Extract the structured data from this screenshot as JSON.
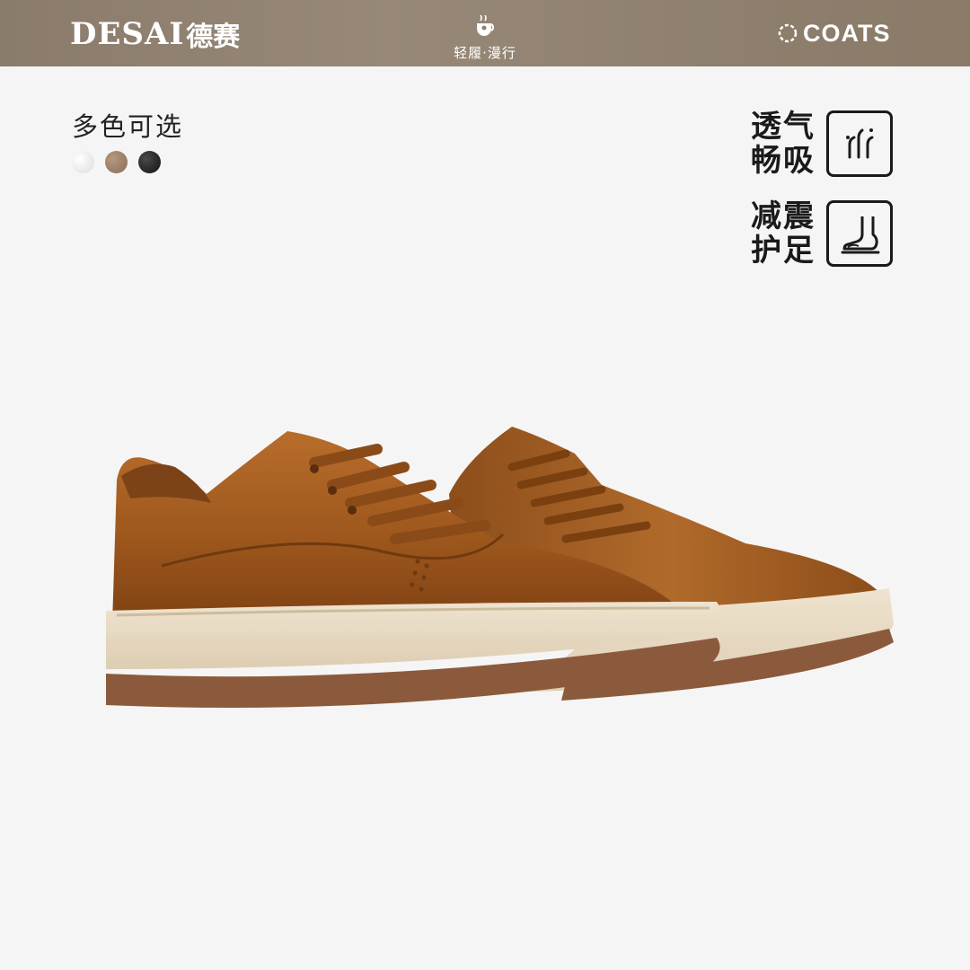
{
  "header": {
    "brand_en": "DESAI",
    "brand_cn": "德赛",
    "slogan": "轻履·漫行",
    "partner": "COATS",
    "bg_color": "#8f806f"
  },
  "colors": {
    "title": "多色可选",
    "swatches": [
      {
        "name": "white",
        "color": "#ececea"
      },
      {
        "name": "brown",
        "color": "#9a7d66"
      },
      {
        "name": "black",
        "color": "#1c1c1c"
      }
    ]
  },
  "features": [
    {
      "line1": "透气",
      "line2": "畅吸",
      "icon": "airflow-icon"
    },
    {
      "line1": "减震",
      "line2": "护足",
      "icon": "foot-cushion-icon"
    }
  ],
  "product": {
    "icon": "shoe-image",
    "upper_color": "#a55f22",
    "sole_color": "#e9dcc6",
    "outsole_color": "#8b5a3c"
  }
}
